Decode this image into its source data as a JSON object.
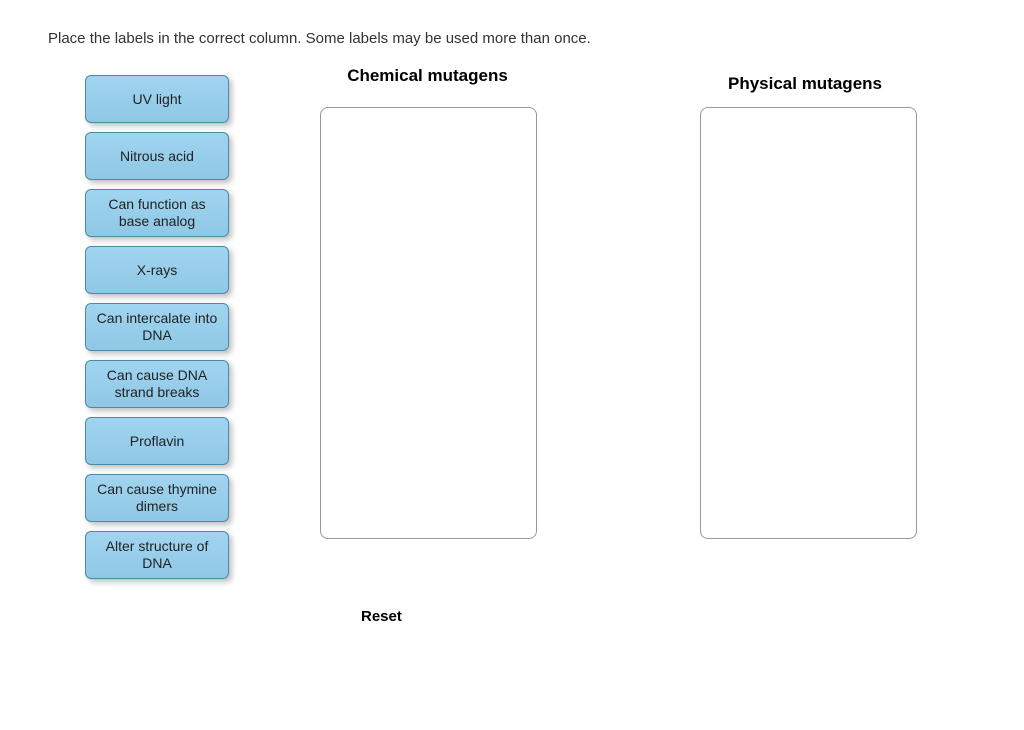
{
  "instructions": "Place the labels in the correct column.  Some labels may be used more than once.",
  "labels": [
    "UV light",
    "Nitrous acid",
    "Can function as base analog",
    "X-rays",
    "Can intercalate into DNA",
    "Can cause DNA strand breaks",
    "Proflavin",
    "Can cause thymine dimers",
    "Alter structure of DNA"
  ],
  "columns": {
    "col1_header": "Chemical mutagens",
    "col2_header": "Physical mutagens"
  },
  "reset_label": "Reset"
}
